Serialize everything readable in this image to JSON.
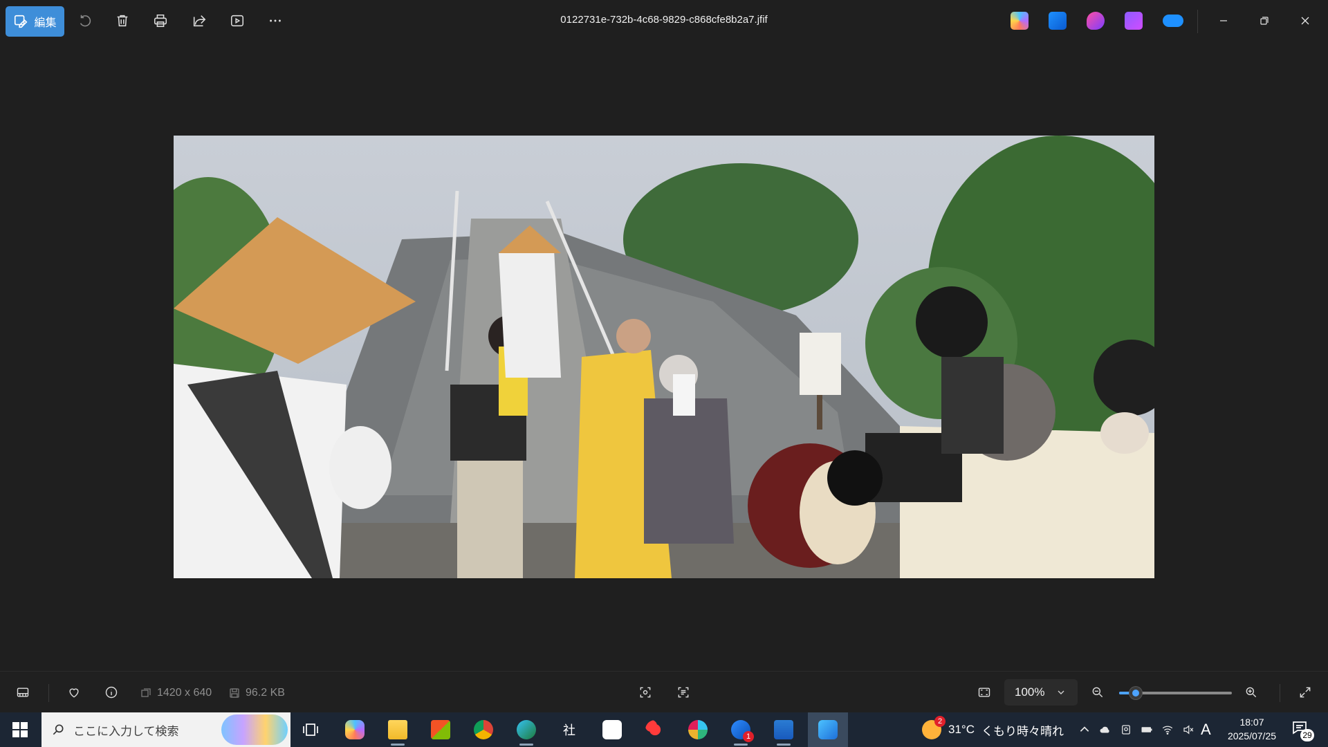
{
  "toolbar": {
    "edit_label": "編集",
    "filename": "0122731e-732b-4c68-9829-c868cfe8b2a7.jfif"
  },
  "photo": {
    "description_icon": "photo-image"
  },
  "status": {
    "dimensions": "1420 x 640",
    "filesize": "96.2 KB",
    "zoom": "100%",
    "zoom_fraction": 0.15
  },
  "taskbar": {
    "search_placeholder": "ここに入力して検索",
    "weather_temp": "31°C",
    "weather_desc": "くもり時々晴れ",
    "weather_badge": "2",
    "mail_badge": "1",
    "ime_label": "A",
    "time": "18:07",
    "date": "2025/07/25",
    "notification_count": "29",
    "app_label_sha": "社"
  },
  "colors": {
    "accent": "#3e8ed9",
    "background": "#1f1f1f",
    "taskbar": "#1c2634"
  }
}
